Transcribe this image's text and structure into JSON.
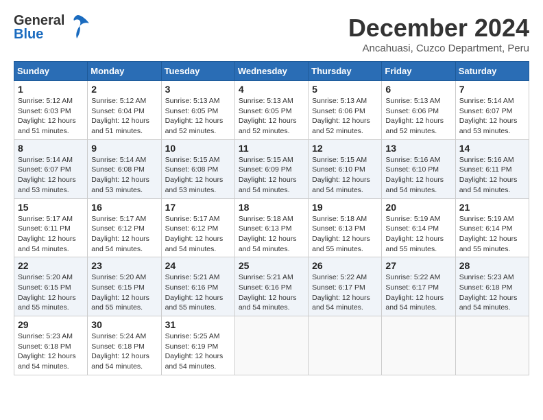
{
  "header": {
    "logo_general": "General",
    "logo_blue": "Blue",
    "title": "December 2024",
    "subtitle": "Ancahuasi, Cuzco Department, Peru"
  },
  "calendar": {
    "weekdays": [
      "Sunday",
      "Monday",
      "Tuesday",
      "Wednesday",
      "Thursday",
      "Friday",
      "Saturday"
    ],
    "weeks": [
      [
        null,
        null,
        {
          "day": 1,
          "sunrise": "5:12 AM",
          "sunset": "6:03 PM",
          "daylight": "12 hours and 51 minutes."
        },
        {
          "day": 2,
          "sunrise": "5:12 AM",
          "sunset": "6:04 PM",
          "daylight": "12 hours and 51 minutes."
        },
        {
          "day": 3,
          "sunrise": "5:13 AM",
          "sunset": "6:05 PM",
          "daylight": "12 hours and 52 minutes."
        },
        {
          "day": 4,
          "sunrise": "5:13 AM",
          "sunset": "6:05 PM",
          "daylight": "12 hours and 52 minutes."
        },
        {
          "day": 5,
          "sunrise": "5:13 AM",
          "sunset": "6:06 PM",
          "daylight": "12 hours and 52 minutes."
        },
        {
          "day": 6,
          "sunrise": "5:13 AM",
          "sunset": "6:06 PM",
          "daylight": "12 hours and 52 minutes."
        },
        {
          "day": 7,
          "sunrise": "5:14 AM",
          "sunset": "6:07 PM",
          "daylight": "12 hours and 53 minutes."
        }
      ],
      [
        {
          "day": 8,
          "sunrise": "5:14 AM",
          "sunset": "6:07 PM",
          "daylight": "12 hours and 53 minutes."
        },
        {
          "day": 9,
          "sunrise": "5:14 AM",
          "sunset": "6:08 PM",
          "daylight": "12 hours and 53 minutes."
        },
        {
          "day": 10,
          "sunrise": "5:15 AM",
          "sunset": "6:08 PM",
          "daylight": "12 hours and 53 minutes."
        },
        {
          "day": 11,
          "sunrise": "5:15 AM",
          "sunset": "6:09 PM",
          "daylight": "12 hours and 54 minutes."
        },
        {
          "day": 12,
          "sunrise": "5:15 AM",
          "sunset": "6:10 PM",
          "daylight": "12 hours and 54 minutes."
        },
        {
          "day": 13,
          "sunrise": "5:16 AM",
          "sunset": "6:10 PM",
          "daylight": "12 hours and 54 minutes."
        },
        {
          "day": 14,
          "sunrise": "5:16 AM",
          "sunset": "6:11 PM",
          "daylight": "12 hours and 54 minutes."
        }
      ],
      [
        {
          "day": 15,
          "sunrise": "5:17 AM",
          "sunset": "6:11 PM",
          "daylight": "12 hours and 54 minutes."
        },
        {
          "day": 16,
          "sunrise": "5:17 AM",
          "sunset": "6:12 PM",
          "daylight": "12 hours and 54 minutes."
        },
        {
          "day": 17,
          "sunrise": "5:17 AM",
          "sunset": "6:12 PM",
          "daylight": "12 hours and 54 minutes."
        },
        {
          "day": 18,
          "sunrise": "5:18 AM",
          "sunset": "6:13 PM",
          "daylight": "12 hours and 54 minutes."
        },
        {
          "day": 19,
          "sunrise": "5:18 AM",
          "sunset": "6:13 PM",
          "daylight": "12 hours and 55 minutes."
        },
        {
          "day": 20,
          "sunrise": "5:19 AM",
          "sunset": "6:14 PM",
          "daylight": "12 hours and 55 minutes."
        },
        {
          "day": 21,
          "sunrise": "5:19 AM",
          "sunset": "6:14 PM",
          "daylight": "12 hours and 55 minutes."
        }
      ],
      [
        {
          "day": 22,
          "sunrise": "5:20 AM",
          "sunset": "6:15 PM",
          "daylight": "12 hours and 55 minutes."
        },
        {
          "day": 23,
          "sunrise": "5:20 AM",
          "sunset": "6:15 PM",
          "daylight": "12 hours and 55 minutes."
        },
        {
          "day": 24,
          "sunrise": "5:21 AM",
          "sunset": "6:16 PM",
          "daylight": "12 hours and 55 minutes."
        },
        {
          "day": 25,
          "sunrise": "5:21 AM",
          "sunset": "6:16 PM",
          "daylight": "12 hours and 54 minutes."
        },
        {
          "day": 26,
          "sunrise": "5:22 AM",
          "sunset": "6:17 PM",
          "daylight": "12 hours and 54 minutes."
        },
        {
          "day": 27,
          "sunrise": "5:22 AM",
          "sunset": "6:17 PM",
          "daylight": "12 hours and 54 minutes."
        },
        {
          "day": 28,
          "sunrise": "5:23 AM",
          "sunset": "6:18 PM",
          "daylight": "12 hours and 54 minutes."
        }
      ],
      [
        {
          "day": 29,
          "sunrise": "5:23 AM",
          "sunset": "6:18 PM",
          "daylight": "12 hours and 54 minutes."
        },
        {
          "day": 30,
          "sunrise": "5:24 AM",
          "sunset": "6:18 PM",
          "daylight": "12 hours and 54 minutes."
        },
        {
          "day": 31,
          "sunrise": "5:25 AM",
          "sunset": "6:19 PM",
          "daylight": "12 hours and 54 minutes."
        },
        null,
        null,
        null,
        null
      ]
    ]
  }
}
